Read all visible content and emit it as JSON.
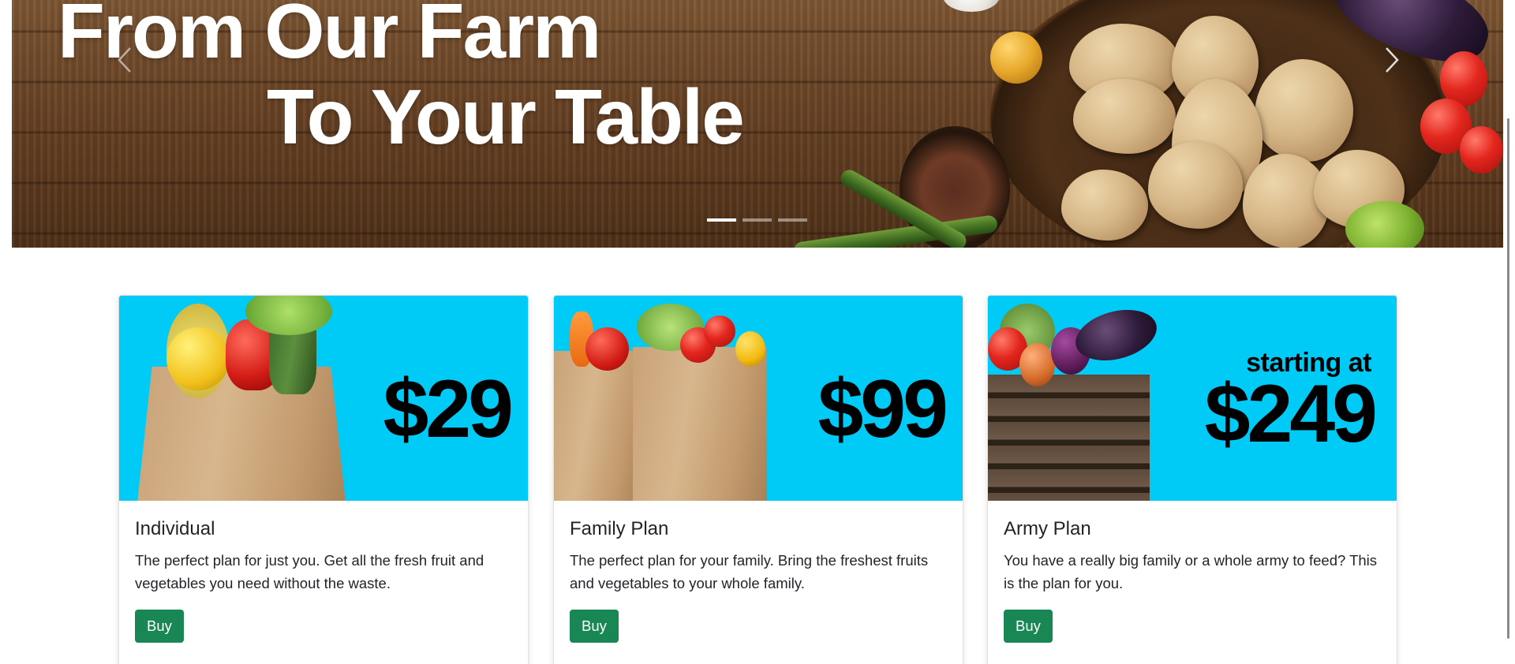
{
  "hero": {
    "title_line_1": "From Our Farm",
    "title_line_2": "To Your Table",
    "prev_icon": "chevron-left-icon",
    "next_icon": "chevron-right-icon",
    "slide_count": 3,
    "active_slide": 1
  },
  "plans": [
    {
      "price_prefix": "",
      "price": "$29",
      "title": "Individual",
      "description": "The perfect plan for just you. Get all the fresh fruit and vegetables you need without the waste.",
      "button_label": "Buy"
    },
    {
      "price_prefix": "",
      "price": "$99",
      "title": "Family Plan",
      "description": "The perfect plan for your family. Bring the freshest fruits and vegetables to your whole family.",
      "button_label": "Buy"
    },
    {
      "price_prefix": "starting at",
      "price": "$249",
      "title": "Army Plan",
      "description": "You have a really big family or a whole army to feed? This is the plan for you.",
      "button_label": "Buy"
    }
  ],
  "colors": {
    "card_image_background": "#00cbf7",
    "buy_button": "#198754",
    "text": "#212529"
  }
}
